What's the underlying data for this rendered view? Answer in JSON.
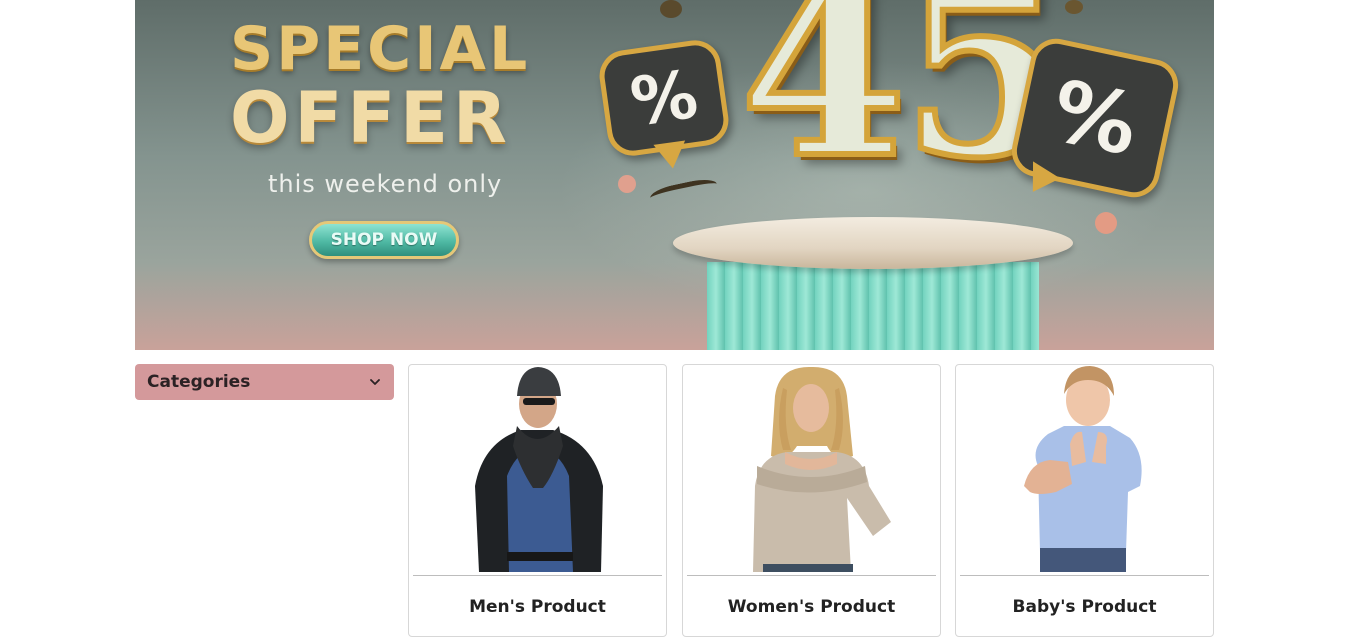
{
  "banner": {
    "headline_line1": "SPECIAL",
    "headline_line2": "OFFER",
    "subtitle": "this weekend only",
    "cta_label": "SHOP NOW",
    "discount_number": "45",
    "percent_symbol": "%"
  },
  "sidebar": {
    "categories_label": "Categories"
  },
  "products": [
    {
      "title": "Men's Product"
    },
    {
      "title": "Women's Product"
    },
    {
      "title": "Baby's Product"
    }
  ],
  "colors": {
    "categories_bg": "#d4999b",
    "gold": "#d7a742",
    "teal": "#4fb9a4"
  },
  "icons": {
    "dropdown": "chevron-down-icon"
  }
}
